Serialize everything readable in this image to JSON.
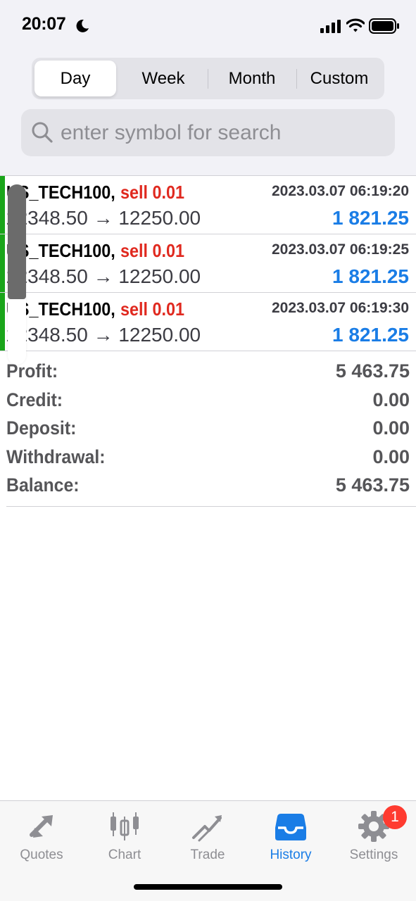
{
  "status_bar": {
    "time": "20:07"
  },
  "tabs": [
    {
      "label": "Day",
      "active": true
    },
    {
      "label": "Week",
      "active": false
    },
    {
      "label": "Month",
      "active": false
    },
    {
      "label": "Custom",
      "active": false
    }
  ],
  "search": {
    "placeholder": "enter symbol for search",
    "value": ""
  },
  "deals": [
    {
      "symbol": "US_TECH100,",
      "type": "sell 0.01",
      "time": "2023.03.07 06:19:20",
      "prices": "12348.50 → 12250.00",
      "profit": "1 821.25"
    },
    {
      "symbol": "US_TECH100,",
      "type": "sell 0.01",
      "time": "2023.03.07 06:19:25",
      "prices": "12348.50 → 12250.00",
      "profit": "1 821.25"
    },
    {
      "symbol": "US_TECH100,",
      "type": "sell 0.01",
      "time": "2023.03.07 06:19:30",
      "prices": "12348.50 → 12250.00",
      "profit": "1 821.25"
    }
  ],
  "summary": [
    {
      "label": "Profit:",
      "value": "5 463.75"
    },
    {
      "label": "Credit:",
      "value": "0.00"
    },
    {
      "label": "Deposit:",
      "value": "0.00"
    },
    {
      "label": "Withdrawal:",
      "value": "0.00"
    },
    {
      "label": "Balance:",
      "value": "5 463.75"
    }
  ],
  "tabbar": {
    "items": [
      {
        "label": "Quotes",
        "icon": "quotes-icon",
        "active": false
      },
      {
        "label": "Chart",
        "icon": "chart-icon",
        "active": false
      },
      {
        "label": "Trade",
        "icon": "trade-icon",
        "active": false
      },
      {
        "label": "History",
        "icon": "history-icon",
        "active": true
      },
      {
        "label": "Settings",
        "icon": "settings-icon",
        "active": false
      }
    ],
    "settings_badge": "1"
  },
  "colors": {
    "accent_blue": "#1a7de6",
    "sell_red": "#e0291f",
    "deal_bar_green": "#1aa51a",
    "badge_red": "#ff3b30"
  }
}
